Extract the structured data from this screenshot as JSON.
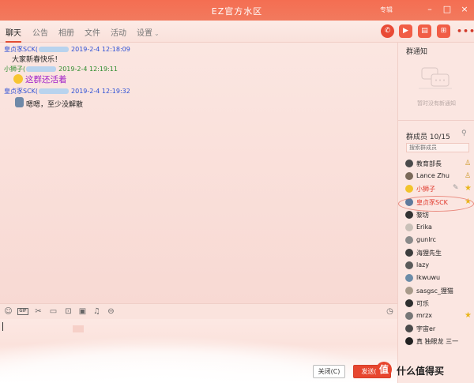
{
  "titlebar": {
    "title": "EZ官方水区",
    "mode": "专辑",
    "minimize": "–",
    "maximize": "□",
    "close": "×"
  },
  "tabs": [
    {
      "label": "聊天",
      "active": true
    },
    {
      "label": "公告"
    },
    {
      "label": "相册"
    },
    {
      "label": "文件"
    },
    {
      "label": "活动"
    },
    {
      "label": "设置"
    }
  ],
  "tab_actions": {
    "phone": "✆",
    "video": "▶",
    "doc": "▤",
    "screen": "⊞",
    "more": "•••"
  },
  "messages": [
    {
      "sender": "皇贞豕SCK(",
      "time": "2019-2-4 12:18:09",
      "text": "大家新春快乐！"
    },
    {
      "sender": "小狮子(",
      "time": "2019-2-4 12:19:11",
      "text": "这群还活着"
    },
    {
      "sender": "皇贞豕SCK(",
      "time": "2019-2-4 12:19:32",
      "text": "嗯嗯，至少没解散"
    }
  ],
  "toolbar_icons": [
    "smiley-icon",
    "gif-icon",
    "scissors-icon",
    "folder-icon",
    "window-icon",
    "image-icon",
    "bell-icon",
    "more-icon",
    "clock-icon"
  ],
  "buttons": {
    "close": "关闭(C)",
    "send": "发送(S)"
  },
  "sidebar": {
    "notice_title": "群通知",
    "notice_empty": "暂时没有新通知",
    "members_title": "群成员 10/15",
    "search_placeholder": "搜索群成员",
    "members": [
      {
        "name": "教育部長",
        "role": "person"
      },
      {
        "name": "Lance Zhu",
        "role": "person"
      },
      {
        "name": "小狮子",
        "role": "star",
        "highlight": true
      },
      {
        "name": "皇贞豕SCK",
        "role": "star",
        "highlight": true
      },
      {
        "name": "黎坊"
      },
      {
        "name": "Erika"
      },
      {
        "name": "gunlrc"
      },
      {
        "name": "海狸先生"
      },
      {
        "name": "lazy"
      },
      {
        "name": "lkwuwu"
      },
      {
        "name": "sasgsc_狸猫"
      },
      {
        "name": "可乐"
      },
      {
        "name": "mrzx",
        "role": "star"
      },
      {
        "name": "宇宙er"
      },
      {
        "name": "真 独眼龙 三一"
      }
    ]
  },
  "watermark": {
    "logo": "值",
    "text": "什么值得买"
  },
  "colors": {
    "accent": "#f46e52",
    "send": "#e7462f",
    "member_highlight": "#e0372a",
    "link_blue": "#2b4fd6",
    "green": "#2c8c2c",
    "purple": "#a020c8"
  }
}
